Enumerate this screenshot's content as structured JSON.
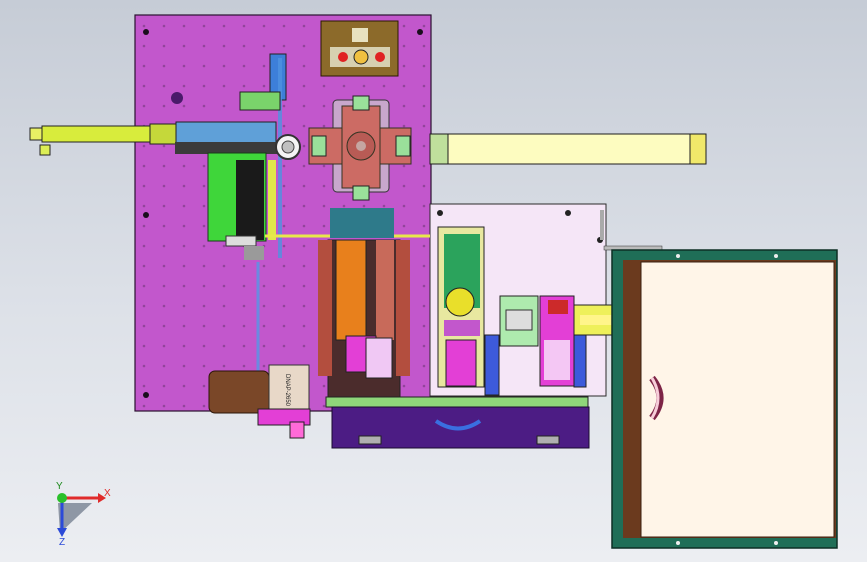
{
  "viewport": {
    "background": [
      "#c6ccd6",
      "#eceef2"
    ]
  },
  "colors": {
    "main_plate": "#c257cc",
    "right_plate": "#f5e6f7",
    "tray_frame": "#1f6e57",
    "tray_inner": "#fff5e8",
    "tray_brown": "#6b3a1e",
    "rail": "#e8f064",
    "rail_light": "#fdfcc0",
    "cross_table": "#cc6b64",
    "cross_center": "#b85b55",
    "orange_block": "#e8801c",
    "front_box": "#4c1c84",
    "green_part": "#3fd63a",
    "blue_part": "#3d5adb",
    "pink_part": "#e33fd6",
    "motor": "#7a4728",
    "label_plate": "#8c6a2a"
  },
  "motor": {
    "label": "DNAP-2650"
  },
  "triad": {
    "x_label": "X",
    "y_label": "Y",
    "z_label": "Z",
    "icon": "coordinate-triad-icon"
  }
}
